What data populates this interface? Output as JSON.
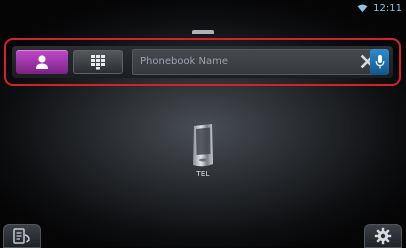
{
  "status_bar": {
    "clock": "12:11",
    "wifi_icon": "wifi-icon"
  },
  "search": {
    "placeholder": "Phonebook Name",
    "contact_button_icon": "person-icon",
    "keypad_button_icon": "keypad-icon",
    "clear_icon": "close-icon",
    "voice_icon": "microphone-icon",
    "highlight_color": "#d0232a",
    "accent_color": "#b040c0"
  },
  "device": {
    "label": "TEL",
    "icon": "phone-icon"
  },
  "footer": {
    "left_icon": "phonebook-icon",
    "right_icon": "gear-icon"
  }
}
